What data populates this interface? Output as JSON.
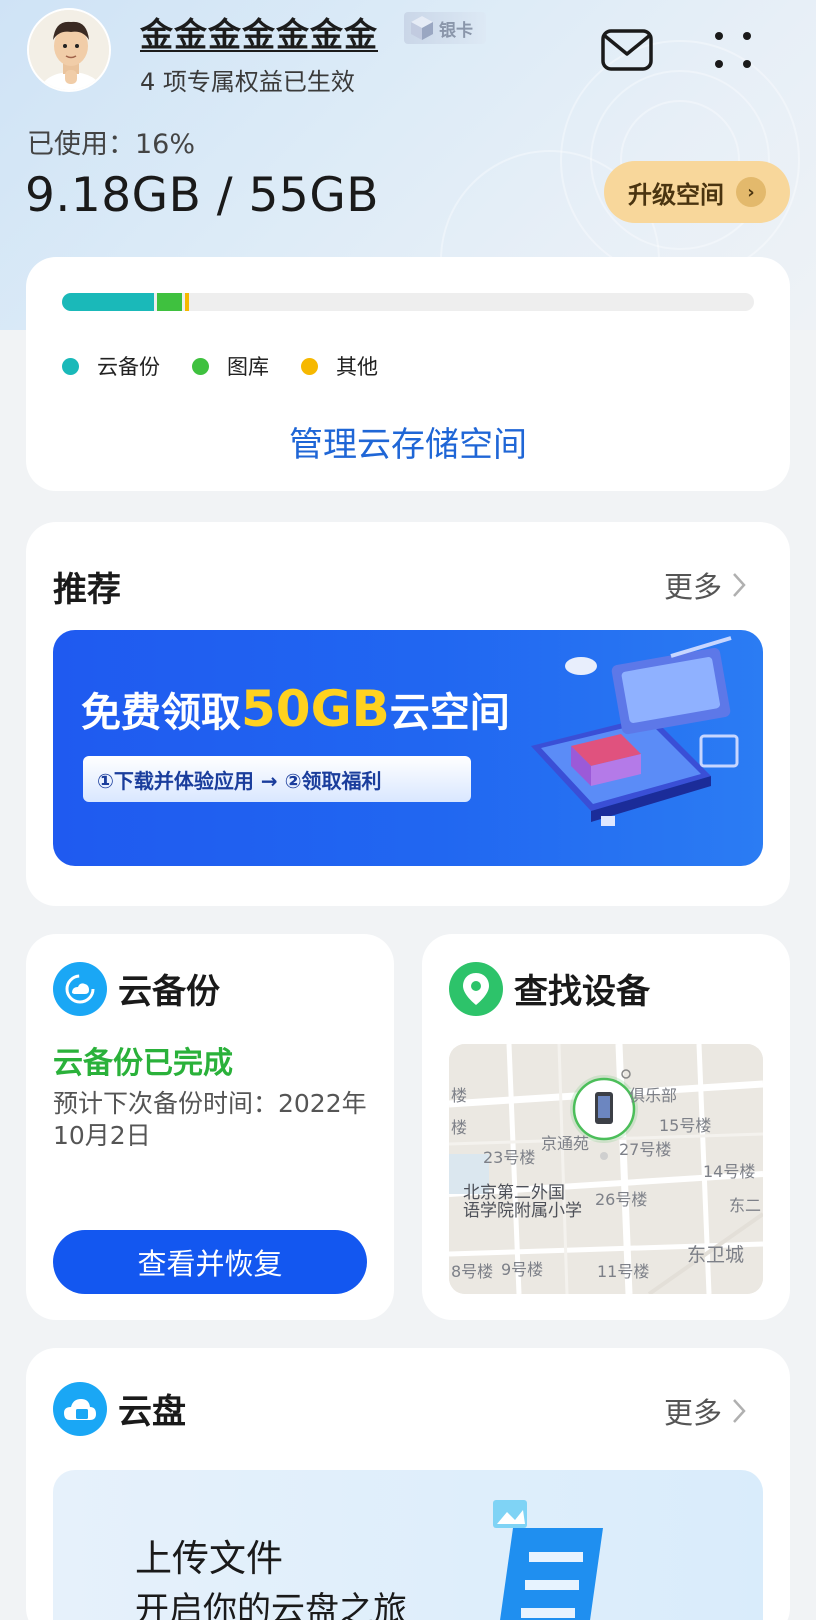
{
  "profile": {
    "name": "金金金金金金金",
    "badge": "银卡",
    "benefits": "4 项专属权益已生效"
  },
  "header_icons": [
    "mail-icon",
    "more-dots-icon"
  ],
  "storage": {
    "used_label": "已使用：16%",
    "used_percent": 16,
    "capacity": "9.18GB / 55GB",
    "upgrade_label": "升级空间",
    "segments": [
      {
        "name": "云备份",
        "color": "#1ab9b9",
        "fraction": 0.133
      },
      {
        "name": "图库",
        "color": "#3fc13f",
        "fraction": 0.036
      },
      {
        "name": "其他",
        "color": "#f6b800",
        "fraction": 0.006
      }
    ],
    "manage_label": "管理云存储空间"
  },
  "recommend": {
    "title": "推荐",
    "more": "更多",
    "banner": {
      "title_prefix": "免费领取",
      "title_highlight": "50GB",
      "title_suffix": "云空间",
      "steps": "①下载并体验应用 → ②领取福利"
    }
  },
  "backup": {
    "title": "云备份",
    "status": "云备份已完成",
    "next": "预计下次备份时间：2022年10月2日",
    "button": "查看并恢复"
  },
  "find_device": {
    "title": "查找设备",
    "map_labels": [
      "楼",
      "楼",
      "俱乐部",
      "15号楼",
      "京通苑",
      "27号楼",
      "23号楼",
      "14号楼",
      "北京第二外国",
      "语学院附属小学",
      "26号楼",
      "东二",
      "东卫城",
      "8号楼",
      "9号楼",
      "11号楼"
    ]
  },
  "cloud_disk": {
    "title": "云盘",
    "more": "更多",
    "line1": "上传文件",
    "line2": "开启你的云盘之旅"
  }
}
